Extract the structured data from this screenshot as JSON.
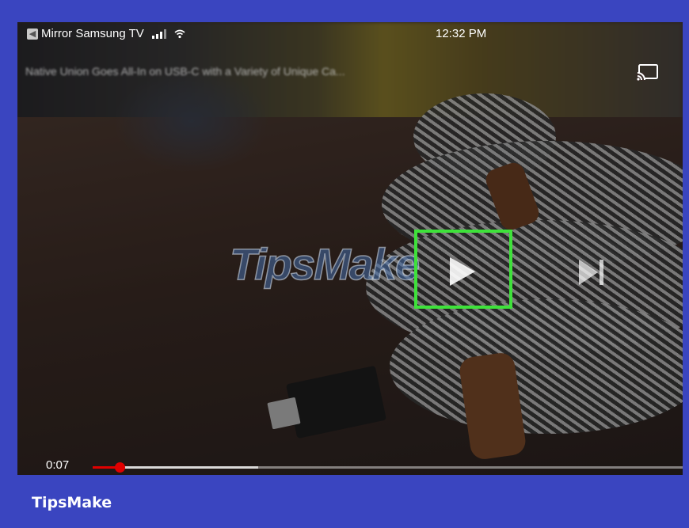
{
  "status_bar": {
    "back_app_label": "Mirror Samsung TV",
    "time": "12:32 PM"
  },
  "video": {
    "title": "Native Union Goes All-In on USB-C with a Variety of Unique Ca...",
    "current_time": "0:07",
    "progress_fraction": 0.045,
    "buffered_fraction": 0.28
  },
  "watermark": "TipsMake",
  "icons": {
    "back": "back-arrow-icon",
    "signal": "signal-bars-icon",
    "wifi": "wifi-icon",
    "cast": "cast-icon",
    "play": "play-icon",
    "next": "skip-next-icon"
  },
  "colors": {
    "background": "#3a45c0",
    "highlight": "#3ee23a",
    "progress": "#e00000"
  },
  "footer": {
    "brand": "TipsMake"
  }
}
